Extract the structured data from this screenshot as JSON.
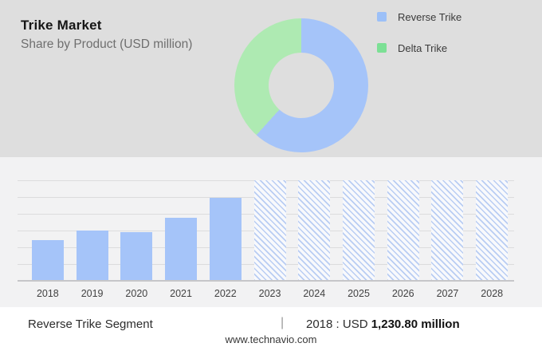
{
  "header": {
    "title": "Trike Market",
    "subtitle": "Share by Product (USD million)",
    "legend": [
      {
        "label": "Reverse Trike",
        "swatch_color": "#9cc0f8"
      },
      {
        "label": "Delta Trike",
        "swatch_color": "#7ce095"
      }
    ]
  },
  "chart_data": [
    {
      "type": "pie",
      "subtype": "donut",
      "title": "Share by Product (USD million)",
      "labels": [
        "Reverse Trike",
        "Delta Trike"
      ],
      "values_pct": [
        61.7,
        38.3
      ],
      "colors": [
        "#a5c4f9",
        "#aeeab2"
      ],
      "start_angle_deg": 0,
      "legend_position": "right",
      "hole_ratio": 0.49
    },
    {
      "type": "bar",
      "title": "Trike Market by year (actual 2018-2022, forecast 2023-2028)",
      "categories": [
        "2018",
        "2019",
        "2020",
        "2021",
        "2022",
        "2023",
        "2024",
        "2025",
        "2026",
        "2027",
        "2028"
      ],
      "bar_color": "#a5c4f9",
      "forecast_style": "diagonal-hatch-full-height",
      "gridlines": true,
      "y_axis_labels": false,
      "known_points": {
        "2018": "USD 1,230.80 million"
      },
      "bars": [
        {
          "year": "2018",
          "height_pct": 40.5,
          "forecast": false
        },
        {
          "year": "2019",
          "height_pct": 50.0,
          "forecast": false
        },
        {
          "year": "2020",
          "height_pct": 48.4,
          "forecast": false
        },
        {
          "year": "2021",
          "height_pct": 62.7,
          "forecast": false
        },
        {
          "year": "2022",
          "height_pct": 82.5,
          "forecast": false
        },
        {
          "year": "2023",
          "height_pct": 100,
          "forecast": true
        },
        {
          "year": "2024",
          "height_pct": 100,
          "forecast": true
        },
        {
          "year": "2025",
          "height_pct": 100,
          "forecast": true
        },
        {
          "year": "2026",
          "height_pct": 100,
          "forecast": true
        },
        {
          "year": "2027",
          "height_pct": 100,
          "forecast": true
        },
        {
          "year": "2028",
          "height_pct": 100,
          "forecast": true
        }
      ]
    }
  ],
  "footer": {
    "segment_label": "Reverse Trike Segment",
    "separator": "|",
    "stat_prefix": "2018 : USD",
    "stat_value": "1,230.80 million",
    "website": "www.technavio.com"
  }
}
